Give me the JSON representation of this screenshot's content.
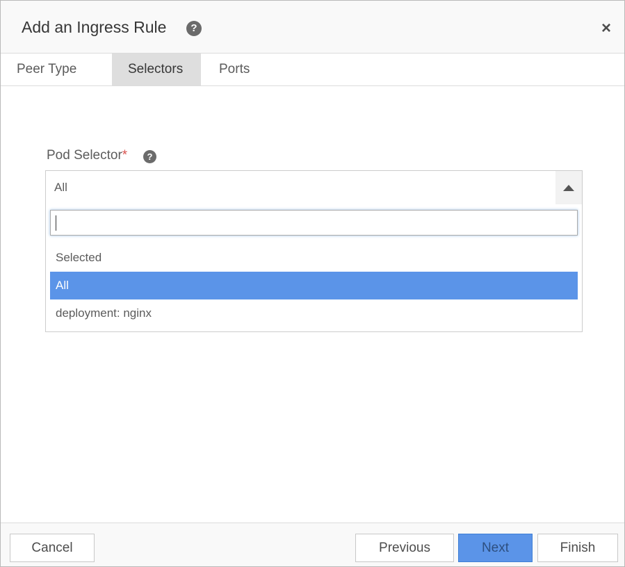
{
  "dialog": {
    "title": "Add an Ingress Rule",
    "help_glyph": "?",
    "close_glyph": "×"
  },
  "tabs": [
    {
      "label": "Peer Type",
      "active": false
    },
    {
      "label": "Selectors",
      "active": true
    },
    {
      "label": "Ports",
      "active": false
    }
  ],
  "pod_selector": {
    "label": "Pod Selector",
    "required_mark": "*",
    "help_glyph": "?",
    "selected_value": "All",
    "search_value": "",
    "options": [
      "Selected",
      "All",
      "deployment: nginx"
    ],
    "highlighted_option": "All"
  },
  "footer": {
    "cancel_label": "Cancel",
    "previous_label": "Previous",
    "next_label": "Next",
    "finish_label": "Finish"
  },
  "colors": {
    "accent": "#5b94e8",
    "required": "#d9534f",
    "active_tab_bg": "#dedede"
  },
  "icons": {
    "help": "question-circle-icon",
    "close": "close-icon",
    "dropdown": "caret-up-icon"
  }
}
